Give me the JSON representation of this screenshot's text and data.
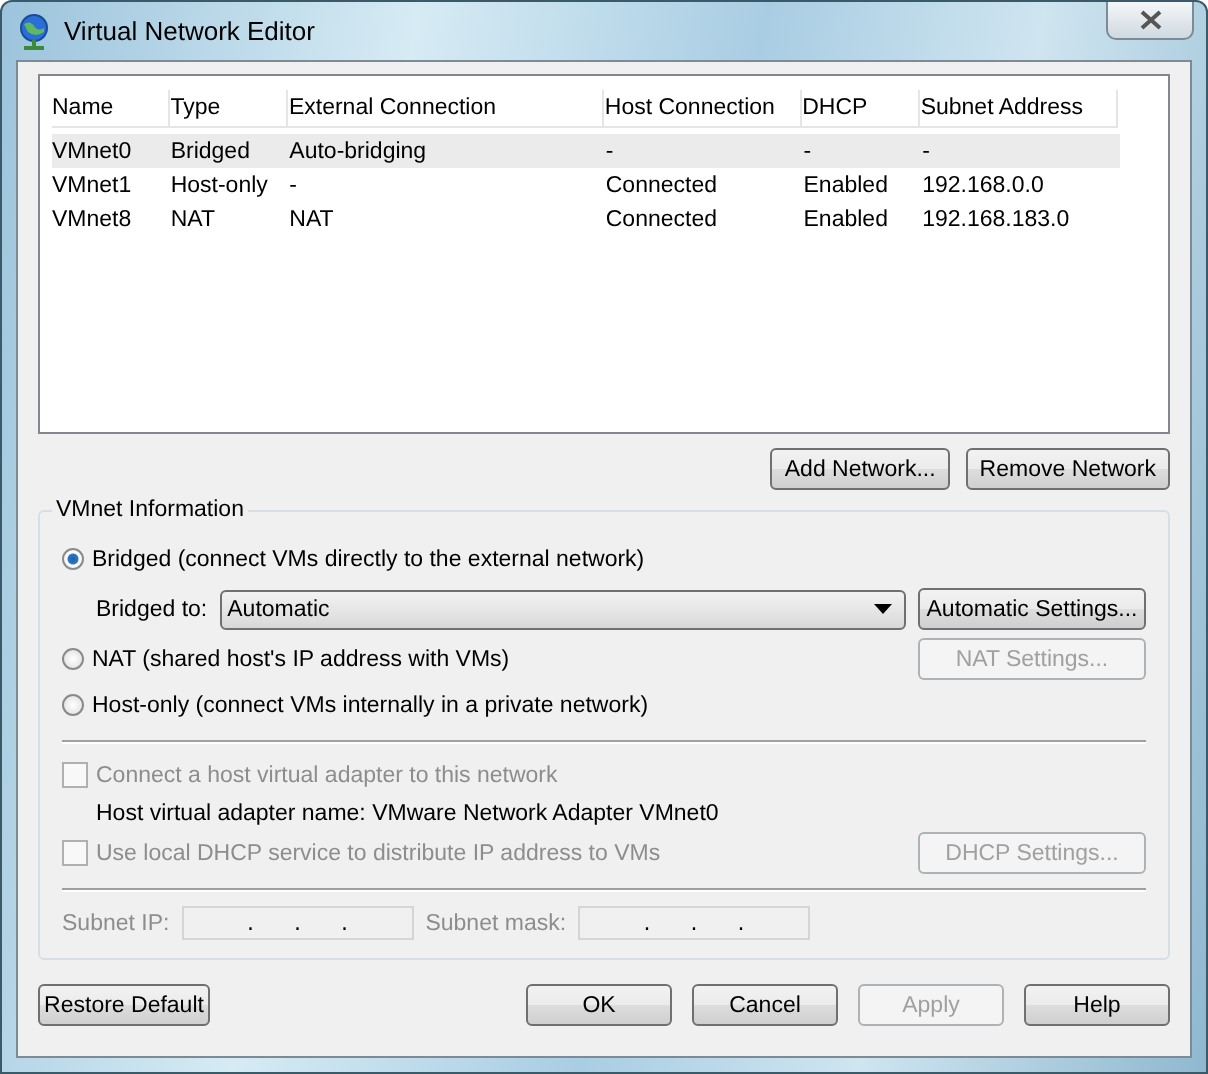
{
  "window": {
    "title": "Virtual Network Editor"
  },
  "table": {
    "columns": [
      "Name",
      "Type",
      "External Connection",
      "Host Connection",
      "DHCP",
      "Subnet Address"
    ],
    "rows": [
      {
        "cells": [
          "VMnet0",
          "Bridged",
          "Auto-bridging",
          "-",
          "-",
          "-"
        ],
        "selected": true
      },
      {
        "cells": [
          "VMnet1",
          "Host-only",
          "-",
          "Connected",
          "Enabled",
          "192.168.0.0"
        ],
        "selected": false
      },
      {
        "cells": [
          "VMnet8",
          "NAT",
          "NAT",
          "Connected",
          "Enabled",
          "192.168.183.0"
        ],
        "selected": false
      }
    ]
  },
  "network_buttons": [
    {
      "label": "Add Network...",
      "disabled": false
    },
    {
      "label": "Remove Network",
      "disabled": false
    }
  ],
  "vmnet_info": {
    "title": "VMnet Information",
    "modes": [
      {
        "label": "Bridged (connect VMs directly to the external network)",
        "selected": true
      },
      {
        "label": "NAT (shared host's IP address with VMs)",
        "selected": false,
        "button": {
          "label": "NAT Settings...",
          "disabled": true
        }
      },
      {
        "label": "Host-only (connect VMs internally in a private network)",
        "selected": false
      }
    ],
    "bridged_to": {
      "label": "Bridged to:",
      "value": "Automatic",
      "button": {
        "label": "Automatic Settings...",
        "disabled": false
      }
    },
    "host_adapter": {
      "label": "Connect a host virtual adapter to this network",
      "checked": false,
      "disabled": true
    },
    "adapter_name": "Host virtual adapter name: VMware Network Adapter VMnet0",
    "dhcp": {
      "label": "Use local DHCP service to distribute IP address to VMs",
      "checked": false,
      "disabled": true,
      "button": {
        "label": "DHCP Settings...",
        "disabled": true
      }
    },
    "subnet_ip": {
      "label": "Subnet IP:",
      "separators": [
        ".",
        ".",
        "."
      ],
      "disabled": true
    },
    "subnet_mask": {
      "label": "Subnet mask:",
      "separators": [
        ".",
        ".",
        "."
      ],
      "disabled": true
    }
  },
  "footer": {
    "restore": {
      "label": "Restore Default",
      "disabled": false
    },
    "buttons": [
      {
        "label": "OK",
        "disabled": false
      },
      {
        "label": "Cancel",
        "disabled": false
      },
      {
        "label": "Apply",
        "disabled": true
      },
      {
        "label": "Help",
        "disabled": false
      }
    ]
  }
}
